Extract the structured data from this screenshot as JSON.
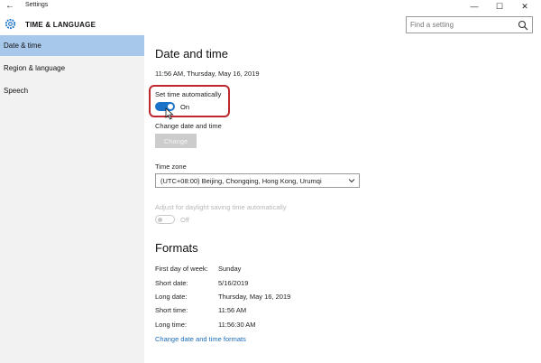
{
  "window": {
    "title": "Settings",
    "controls": {
      "minimize": "—",
      "maximize": "☐",
      "close": "✕"
    }
  },
  "header": {
    "section_title": "TIME & LANGUAGE",
    "search_placeholder": "Find a setting"
  },
  "sidebar": {
    "items": [
      {
        "label": "Date & time",
        "active": true
      },
      {
        "label": "Region & language",
        "active": false
      },
      {
        "label": "Speech",
        "active": false
      }
    ]
  },
  "main": {
    "title": "Date and time",
    "current_datetime": "11:56 AM, Thursday, May 16, 2019",
    "set_time_auto": {
      "label": "Set time automatically",
      "state": "On",
      "enabled": true
    },
    "change_datetime": {
      "label": "Change date and time",
      "button": "Change"
    },
    "time_zone": {
      "label": "Time zone",
      "value": "(UTC+08:00) Beijing, Chongqing, Hong Kong, Urumqi"
    },
    "daylight": {
      "label": "Adjust for daylight saving time automatically",
      "state": "Off"
    }
  },
  "formats": {
    "title": "Formats",
    "rows": [
      {
        "label": "First day of week:",
        "value": "Sunday"
      },
      {
        "label": "Short date:",
        "value": "5/16/2019"
      },
      {
        "label": "Long date:",
        "value": "Thursday, May 16, 2019"
      },
      {
        "label": "Short time:",
        "value": "11:56 AM"
      },
      {
        "label": "Long time:",
        "value": "11:56:30 AM"
      }
    ],
    "link": "Change date and time formats"
  },
  "colors": {
    "accent": "#1a73c8",
    "sidebar_active": "#a7c8eb",
    "highlight": "#c0262d",
    "link": "#1a6bb8"
  }
}
